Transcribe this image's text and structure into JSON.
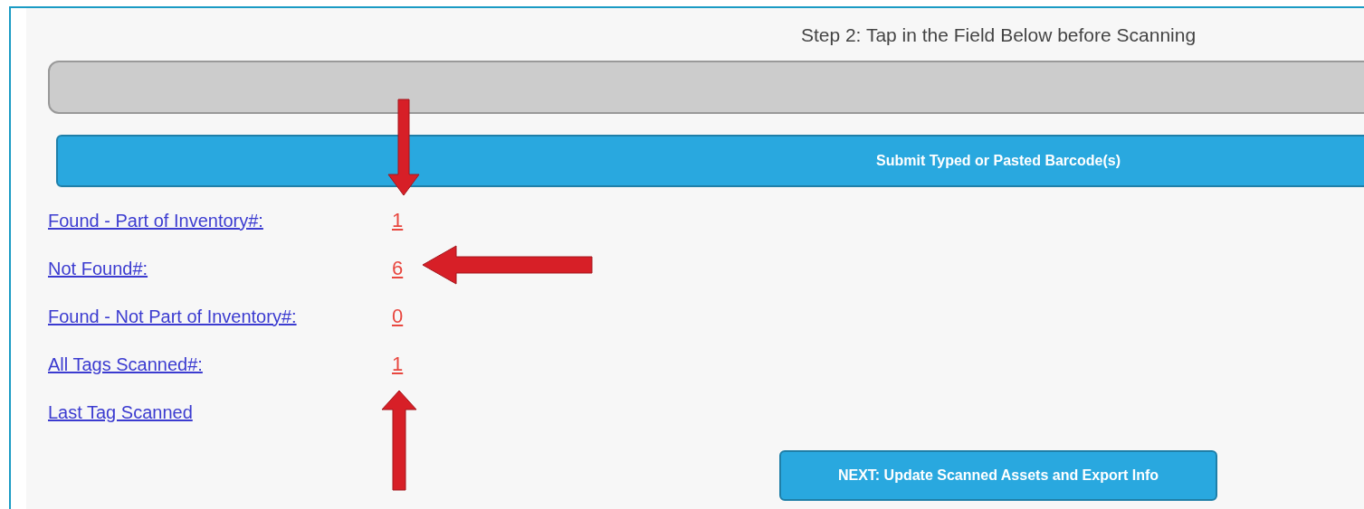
{
  "step_label": "Step 2: Tap in the Field Below before Scanning",
  "submit_button": "Submit Typed or Pasted Barcode(s)",
  "stats": [
    {
      "label": "Found - Part of Inventory#:",
      "value": "1"
    },
    {
      "label": "Not Found#:",
      "value": "6"
    },
    {
      "label": "Found - Not Part of Inventory#:",
      "value": "0"
    },
    {
      "label": "All Tags Scanned#:",
      "value": "1"
    },
    {
      "label": "Last Tag Scanned"
    }
  ],
  "next_button": "NEXT: Update Scanned Assets and Export Info"
}
